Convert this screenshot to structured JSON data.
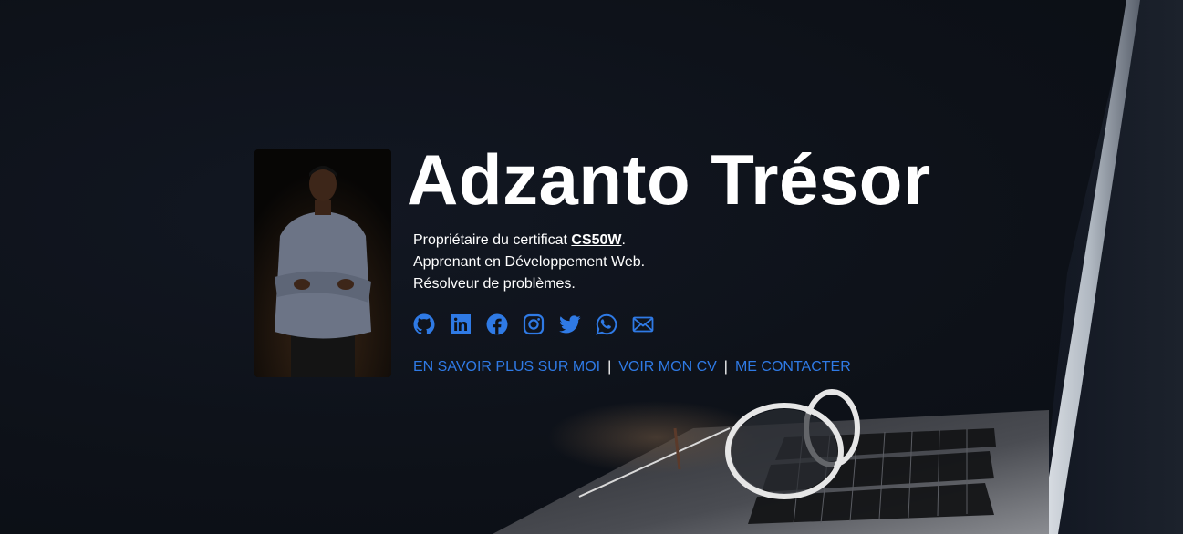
{
  "profile": {
    "name": "Adzanto Trésor",
    "bio_line1_prefix": "Propriétaire du certificat ",
    "bio_line1_link": "CS50W",
    "bio_line1_suffix": ".",
    "bio_line2": "Apprenant en Développement Web.",
    "bio_line3": "Résolveur de problèmes."
  },
  "socials": [
    {
      "icon": "github-icon"
    },
    {
      "icon": "linkedin-icon"
    },
    {
      "icon": "facebook-icon"
    },
    {
      "icon": "instagram-icon"
    },
    {
      "icon": "twitter-icon"
    },
    {
      "icon": "whatsapp-icon"
    },
    {
      "icon": "email-icon"
    }
  ],
  "nav": {
    "about": "EN SAVOIR PLUS SUR MOI",
    "cv": "VOIR MON CV",
    "contact": "ME CONTACTER",
    "separator": "|"
  },
  "colors": {
    "background": "#0e1219",
    "accent": "#2f7ae5",
    "text": "#ffffff"
  }
}
